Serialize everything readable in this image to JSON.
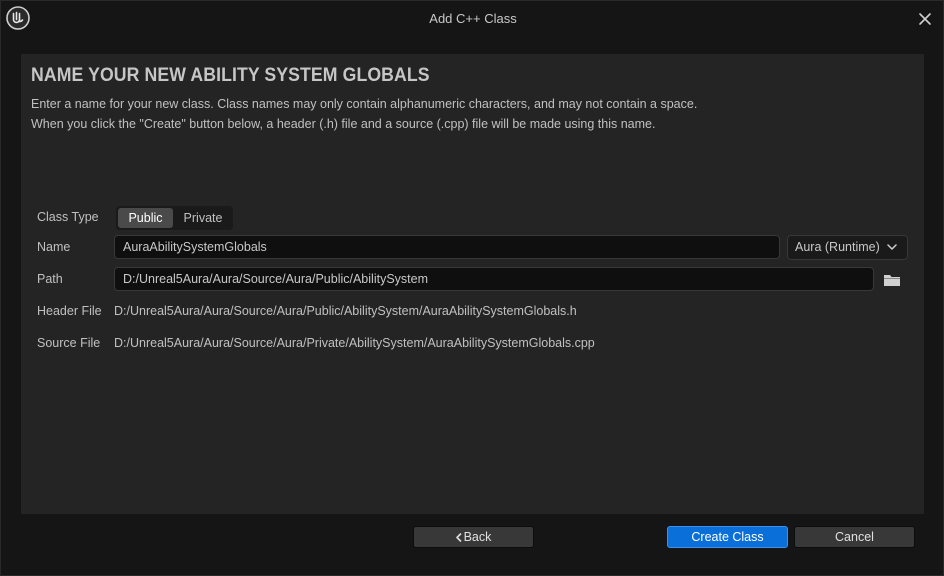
{
  "window": {
    "title": "Add C++ Class",
    "logo_icon": "unreal-engine-logo-icon",
    "close_icon": "close-icon"
  },
  "header": {
    "title": "NAME YOUR NEW ABILITY SYSTEM GLOBALS",
    "description_line1": "Enter a name for your new class. Class names may only contain alphanumeric characters, and may not contain a space.",
    "description_line2": "When you click the \"Create\" button below, a header (.h) file and a source (.cpp) file will be made using this name."
  },
  "form": {
    "class_type": {
      "label": "Class Type",
      "options": [
        "Public",
        "Private"
      ],
      "selected": "Public"
    },
    "name": {
      "label": "Name",
      "value": "AuraAbilitySystemGlobals"
    },
    "module": {
      "selected": "Aura (Runtime)",
      "icon": "chevron-down-icon"
    },
    "path": {
      "label": "Path",
      "value": "D:/Unreal5Aura/Aura/Source/Aura/Public/AbilitySystem",
      "browse_icon": "folder-icon"
    },
    "header_file": {
      "label": "Header File",
      "value": "D:/Unreal5Aura/Aura/Source/Aura/Public/AbilitySystem/AuraAbilitySystemGlobals.h"
    },
    "source_file": {
      "label": "Source File",
      "value": "D:/Unreal5Aura/Aura/Source/Aura/Private/AbilitySystem/AuraAbilitySystemGlobals.cpp"
    }
  },
  "footer": {
    "back_label": "Back",
    "create_label": "Create Class",
    "cancel_label": "Cancel"
  },
  "colors": {
    "accent": "#0a6fd8",
    "panel": "#242424",
    "background": "#151515"
  }
}
